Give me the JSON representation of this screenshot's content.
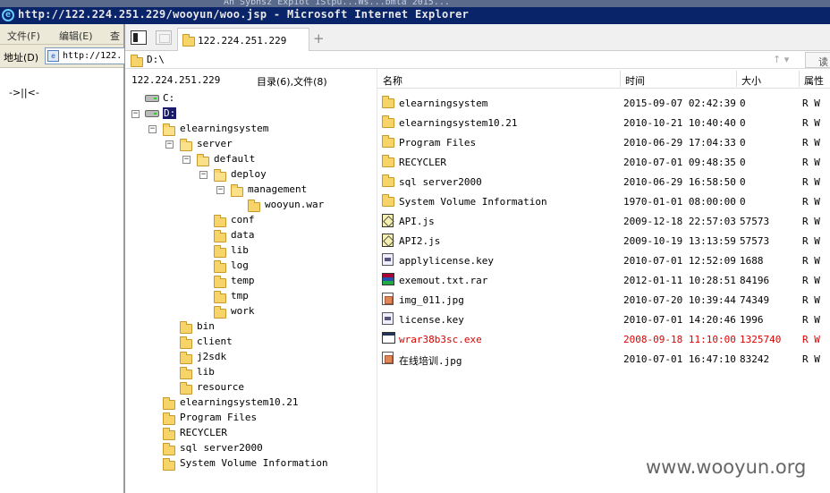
{
  "window": {
    "bg_fragment": "An Sybnsz Expiot IStpu...Ws...bmta 2015...",
    "title": "http://122.224.251.229/wooyun/woo.jsp - Microsoft Internet Explorer"
  },
  "ie": {
    "menu": [
      "文件(F)",
      "编辑(E)",
      "查"
    ],
    "address_label": "地址(D)",
    "address_value": "http://122.",
    "page_text": "->||<-"
  },
  "fm": {
    "tab_label": "122.224.251.229",
    "add_tab": "+",
    "path": "D:\\",
    "sort_icon": "↑ ▾",
    "read_button": "读",
    "host": "122.224.251.229",
    "counts": "目录(6),文件(8)",
    "tree": [
      {
        "label": "C:",
        "kind": "drive"
      },
      {
        "label": "D:",
        "kind": "drive"
      },
      {
        "label": "elearningsystem"
      },
      {
        "label": "server"
      },
      {
        "label": "default"
      },
      {
        "label": "deploy"
      },
      {
        "label": "management"
      },
      {
        "label": "wooyun.war"
      },
      {
        "label": "conf"
      },
      {
        "label": "data"
      },
      {
        "label": "lib"
      },
      {
        "label": "log"
      },
      {
        "label": "temp"
      },
      {
        "label": "tmp"
      },
      {
        "label": "work"
      },
      {
        "label": "bin"
      },
      {
        "label": "client"
      },
      {
        "label": "j2sdk"
      },
      {
        "label": "lib"
      },
      {
        "label": "resource"
      },
      {
        "label": "elearningsystem10.21"
      },
      {
        "label": "Program Files"
      },
      {
        "label": "RECYCLER"
      },
      {
        "label": "sql server2000"
      },
      {
        "label": "System Volume Information"
      }
    ],
    "columns": {
      "name": "名称",
      "time": "时间",
      "size": "大小",
      "attr": "属性"
    },
    "files": [
      {
        "name": "elearningsystem",
        "time": "2015-09-07 02:42:39",
        "size": "0",
        "attr": "R W",
        "icon": "folder-icon"
      },
      {
        "name": "elearningsystem10.21",
        "time": "2010-10-21 10:40:40",
        "size": "0",
        "attr": "R W",
        "icon": "folder-icon"
      },
      {
        "name": "Program Files",
        "time": "2010-06-29 17:04:33",
        "size": "0",
        "attr": "R W",
        "icon": "folder-icon"
      },
      {
        "name": "RECYCLER",
        "time": "2010-07-01 09:48:35",
        "size": "0",
        "attr": "R W",
        "icon": "folder-icon"
      },
      {
        "name": "sql server2000",
        "time": "2010-06-29 16:58:50",
        "size": "0",
        "attr": "R W",
        "icon": "folder-icon"
      },
      {
        "name": "System Volume Information",
        "time": "1970-01-01 08:00:00",
        "size": "0",
        "attr": "R W",
        "icon": "folder-icon"
      },
      {
        "name": "API.js",
        "time": "2009-12-18 22:57:03",
        "size": "57573",
        "attr": "R W",
        "icon": "script-file-icon"
      },
      {
        "name": "API2.js",
        "time": "2009-10-19 13:13:59",
        "size": "57573",
        "attr": "R W",
        "icon": "script-file-icon"
      },
      {
        "name": "applylicense.key",
        "time": "2010-07-01 12:52:09",
        "size": "1688",
        "attr": "R W",
        "icon": "key-file-icon"
      },
      {
        "name": "exemout.txt.rar",
        "time": "2012-01-11 10:28:51",
        "size": "84196",
        "attr": "R W",
        "icon": "rar-archive-icon"
      },
      {
        "name": "img_011.jpg",
        "time": "2010-07-20 10:39:44",
        "size": "74349",
        "attr": "R W",
        "icon": "image-file-icon"
      },
      {
        "name": "license.key",
        "time": "2010-07-01 14:20:46",
        "size": "1996",
        "attr": "R W",
        "icon": "key-file-icon"
      },
      {
        "name": "wrar38b3sc.exe",
        "time": "2008-09-18 11:10:00",
        "size": "1325740",
        "attr": "R W",
        "icon": "executable-icon",
        "highlight": true
      },
      {
        "name": "在线培训.jpg",
        "time": "2010-07-01 16:47:10",
        "size": "83242",
        "attr": "R W",
        "icon": "image-file-icon"
      }
    ],
    "highlight_color": "#dd0000"
  },
  "watermark": "www.wooyun.org"
}
